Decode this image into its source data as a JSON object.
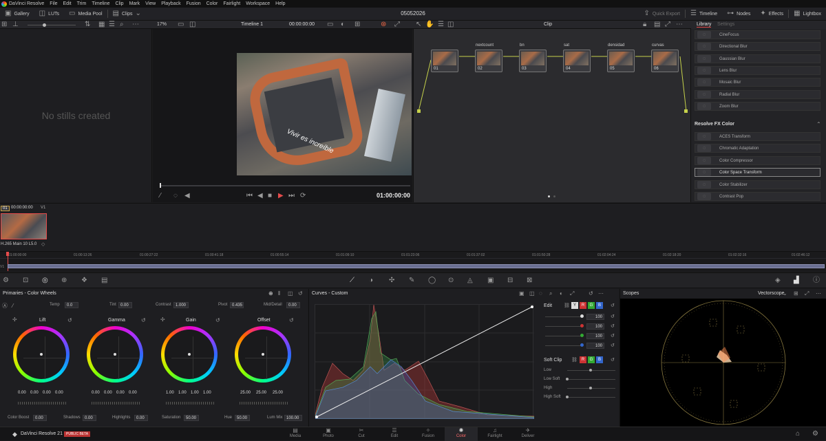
{
  "menubar": {
    "app": "DaVinci Resolve",
    "items": [
      "File",
      "Edit",
      "Trim",
      "Timeline",
      "Clip",
      "Mark",
      "View",
      "Playback",
      "Fusion",
      "Color",
      "Fairlight",
      "Workspace",
      "Help"
    ]
  },
  "topbar": {
    "gallery": "Gallery",
    "luts": "LUTs",
    "media_pool": "Media Pool",
    "clips": "Clips",
    "project": "05052026",
    "quick_export": "Quick Export",
    "timeline": "Timeline",
    "nodes": "Nodes",
    "effects": "Effects",
    "lightbox": "Lightbox"
  },
  "viewer": {
    "zoom": "17%",
    "timeline_name": "Timeline 1",
    "timecode_top": "00:00:00:00",
    "clip_mode": "Clip",
    "timecode": "01:00:00:00",
    "overlay_text": "Vivir es increíble"
  },
  "gallery": {
    "empty_msg": "No stills created"
  },
  "nodes": [
    {
      "num": "01",
      "label": ""
    },
    {
      "num": "02",
      "label": "nextcount"
    },
    {
      "num": "03",
      "label": "bn"
    },
    {
      "num": "04",
      "label": "sat"
    },
    {
      "num": "05",
      "label": "densidad"
    },
    {
      "num": "06",
      "label": "curvas"
    }
  ],
  "library": {
    "tab_library": "Library",
    "tab_settings": "Settings",
    "items_top": [
      "CineFocus",
      "Directional Blur",
      "Gaussian Blur",
      "Lens Blur",
      "Mosaic Blur",
      "Radial Blur",
      "Zoom Blur"
    ],
    "section": "Resolve FX Color",
    "items_color": [
      "ACES Transform",
      "Chromatic Adaptation",
      "Color Compressor",
      "Color Space Transform",
      "Color Stabilizer",
      "Contrast Pop"
    ]
  },
  "clip": {
    "index": "01",
    "timecode": "00:00:00:00",
    "track": "V1",
    "codec": "H.265 Main 10 L5.0"
  },
  "mini_timeline": {
    "ticks": [
      "01:00:00:00",
      "01:00:13:26",
      "01:00:27:22",
      "01:00:41:18",
      "01:00:55:14",
      "01:01:09:10",
      "01:01:23:06",
      "01:01:37:02",
      "01:01:50:28",
      "01:02:04:24",
      "01:02:18:20",
      "01:02:32:16",
      "01:02:46:12"
    ],
    "track": "V1"
  },
  "primaries": {
    "title": "Primaries - Color Wheels",
    "temp_label": "Temp",
    "temp": "0.0",
    "tint_label": "Tint",
    "tint": "0.00",
    "contrast_label": "Contrast",
    "contrast": "1.000",
    "pivot_label": "Pivot",
    "pivot": "0.435",
    "middetail_label": "Mid/Detail",
    "middetail": "0.00",
    "wheels": [
      {
        "name": "Lift",
        "vals": [
          "0.00",
          "0.00",
          "0.00",
          "0.00"
        ]
      },
      {
        "name": "Gamma",
        "vals": [
          "0.00",
          "0.00",
          "0.00",
          "0.00"
        ]
      },
      {
        "name": "Gain",
        "vals": [
          "1.00",
          "1.00",
          "1.00",
          "1.00"
        ]
      },
      {
        "name": "Offset",
        "vals": [
          "25.00",
          "25.00",
          "25.00"
        ]
      }
    ],
    "colorboost_label": "Color Boost",
    "colorboost": "0.00",
    "shadows_label": "Shadows",
    "shadows": "0.00",
    "highlights_label": "Highlights",
    "highlights": "0.00",
    "saturation_label": "Saturation",
    "saturation": "50.00",
    "hue_label": "Hue",
    "hue": "50.00",
    "lummix_label": "Lum Mix",
    "lummix": "100.00"
  },
  "curves": {
    "title": "Curves - Custom",
    "edit": "Edit",
    "y": "Y",
    "r": "R",
    "g": "G",
    "b": "B",
    "vals": [
      "100",
      "100",
      "100",
      "100"
    ],
    "softclip": "Soft Clip",
    "low": "Low",
    "lowsoft": "Low Soft",
    "high": "High",
    "highsoft": "High Soft"
  },
  "scopes": {
    "title": "Scopes",
    "mode": "Vectorscope"
  },
  "pages": {
    "app_name": "DaVinci Resolve 21",
    "badge": "PUBLIC BETA",
    "items": [
      "Media",
      "Photo",
      "Cut",
      "Edit",
      "Fusion",
      "Color",
      "Fairlight",
      "Deliver"
    ],
    "active": "Color"
  },
  "colors": {
    "accent": "#e64b4b",
    "node_link": "#c6d24b"
  }
}
